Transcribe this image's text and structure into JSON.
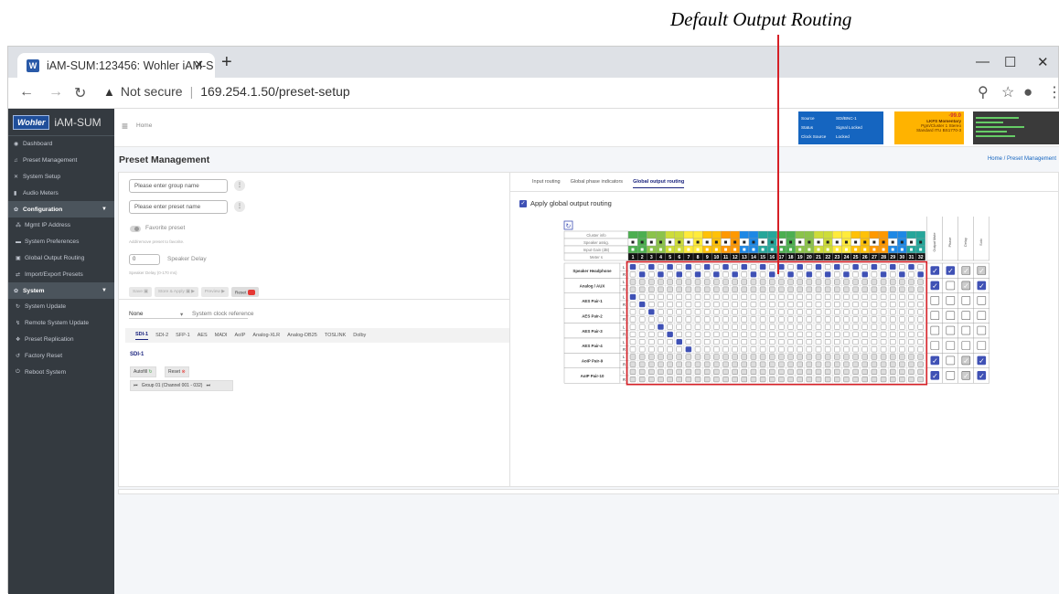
{
  "annotation": {
    "title": "Default Output Routing"
  },
  "browser": {
    "tab_title": "iAM-SUM:123456: Wohler iAM-S",
    "favicon_letter": "W",
    "close_glyph": "✕",
    "newtab_glyph": "+",
    "url_warning": "Not secure",
    "url": "169.254.1.50/preset-setup",
    "win_min": "—",
    "win_max": "☐",
    "win_close": "✕"
  },
  "sidebar": {
    "logo": "Wohler",
    "app_name": "iAM-SUM",
    "items": [
      {
        "icon": "◉",
        "label": "Dashboard",
        "kind": "item"
      },
      {
        "icon": "♫",
        "label": "Preset Management",
        "kind": "item"
      },
      {
        "icon": "✕",
        "label": "System Setup",
        "kind": "item"
      },
      {
        "icon": "▮",
        "label": "Audio Meters",
        "kind": "item"
      },
      {
        "icon": "✿",
        "label": "Configuration",
        "kind": "head"
      },
      {
        "icon": "⁂",
        "label": "Mgmt IP Address",
        "kind": "sub"
      },
      {
        "icon": "▬",
        "label": "System Preferences",
        "kind": "sub"
      },
      {
        "icon": "▣",
        "label": "Global Output Routing",
        "kind": "sub"
      },
      {
        "icon": "⇄",
        "label": "Import/Export Presets",
        "kind": "sub"
      },
      {
        "icon": "✿",
        "label": "System",
        "kind": "head"
      },
      {
        "icon": "↻",
        "label": "System Update",
        "kind": "sub"
      },
      {
        "icon": "↯",
        "label": "Remote System Update",
        "kind": "sub"
      },
      {
        "icon": "❖",
        "label": "Preset Replication",
        "kind": "sub"
      },
      {
        "icon": "↺",
        "label": "Factory Reset",
        "kind": "sub"
      },
      {
        "icon": "⏻",
        "label": "Reboot System",
        "kind": "sub"
      }
    ]
  },
  "topbar": {
    "home": "Home",
    "status": {
      "rows": [
        {
          "k": "Source",
          "v": "SDI/BNC-1"
        },
        {
          "k": "Status",
          "v": "Signal Locked"
        },
        {
          "k": "Clock Source",
          "v": "Locked"
        }
      ]
    },
    "loudness": {
      "value": "-99.0",
      "line2": "LKFS  Momentary",
      "line3": "Pgm/Cluster    1  Stereo",
      "line4": "Standard      ITU BS1770-3"
    },
    "meter_levels": [
      0.55,
      0.35,
      0.62,
      0.4,
      0.5
    ]
  },
  "page": {
    "title": "Preset Management",
    "breadcrumb": "Home  /  Preset Management"
  },
  "left_card": {
    "group_placeholder": "Please enter group name",
    "preset_placeholder": "Please enter preset name",
    "favorite": "Favorite preset",
    "fav_hint": "Add/remove preset to favorite.",
    "delay_value": "0",
    "speaker_delay": "Speaker Delay",
    "delay_hint": "Speaker Delay (0-170 ms)",
    "buttons": [
      "Save",
      "Store & Apply",
      "Preview",
      "Reset"
    ],
    "clock_value": "None",
    "clock_label": "System clock reference",
    "input_tabs": [
      "SDI-1",
      "SDI-2",
      "SFP-1",
      "AES",
      "MADI",
      "AoIP",
      "Analog-XLR",
      "Analog-DB25",
      "TOSLINK",
      "Dolby"
    ],
    "active_input": "SDI-1",
    "autofill": "Autofill",
    "reset": "Reset",
    "group_range": "Group 01 (Channel 001 - 032)"
  },
  "right_card": {
    "tabs": [
      "Input routing",
      "Global phase indicators",
      "Global output routing"
    ],
    "active_tab": "Global output routing",
    "apply": "Apply global output routing",
    "apply_checked": true,
    "header_labels": [
      "Cluster info",
      "Speaker assig.",
      "Input Gain (dB)",
      "Meter s"
    ],
    "channels": [
      "1",
      "2",
      "3",
      "4",
      "5",
      "6",
      "7",
      "8",
      "9",
      "10",
      "11",
      "12",
      "13",
      "14",
      "15",
      "16",
      "17",
      "18",
      "19",
      "20",
      "21",
      "22",
      "23",
      "24",
      "25",
      "26",
      "27",
      "28",
      "29",
      "30",
      "31",
      "32"
    ],
    "extra_cols": [
      "Output Mute",
      "Phase",
      "Delay",
      "Solo"
    ],
    "outputs": [
      {
        "name": "Speaker Headphone",
        "sub": [
          "L",
          "R"
        ],
        "ext": [
          1,
          1,
          2,
          2
        ]
      },
      {
        "name": "Analog / AUX",
        "sub": [
          "L",
          "R"
        ],
        "ext": [
          1,
          0,
          2,
          1
        ]
      },
      {
        "name": "AES Pair-1",
        "sub": [
          "L",
          "R"
        ],
        "ext": [
          0,
          0,
          0,
          0
        ]
      },
      {
        "name": "AES Pair-2",
        "sub": [
          "L",
          "R"
        ],
        "ext": [
          0,
          0,
          0,
          0
        ]
      },
      {
        "name": "AES Pair-3",
        "sub": [
          "L",
          "R"
        ],
        "ext": [
          0,
          0,
          0,
          0
        ]
      },
      {
        "name": "AES Pair-4",
        "sub": [
          "L",
          "R"
        ],
        "ext": [
          0,
          0,
          0,
          0
        ]
      },
      {
        "name": "AoIP Pair-9",
        "sub": [
          "L",
          "R"
        ],
        "ext": [
          1,
          0,
          2,
          1
        ]
      },
      {
        "name": "AoIP Pair-10",
        "sub": [
          "L",
          "R"
        ],
        "ext": [
          1,
          0,
          2,
          1
        ]
      }
    ],
    "checked_cells": {
      "0": [
        1,
        3,
        5,
        7,
        9,
        11,
        13,
        15,
        17,
        19,
        21,
        23,
        25,
        27,
        29,
        31
      ],
      "1": [
        2,
        4,
        6,
        8,
        10,
        12,
        14,
        16,
        18,
        20,
        22,
        24,
        26,
        28,
        30,
        32
      ],
      "4": [
        1
      ],
      "5": [
        2
      ],
      "6": [
        3
      ],
      "8": [
        4
      ],
      "9": [
        5
      ],
      "10": [
        6
      ],
      "11": [
        7
      ]
    },
    "disabled_rows": [
      2,
      3,
      12,
      13,
      14,
      15
    ]
  }
}
